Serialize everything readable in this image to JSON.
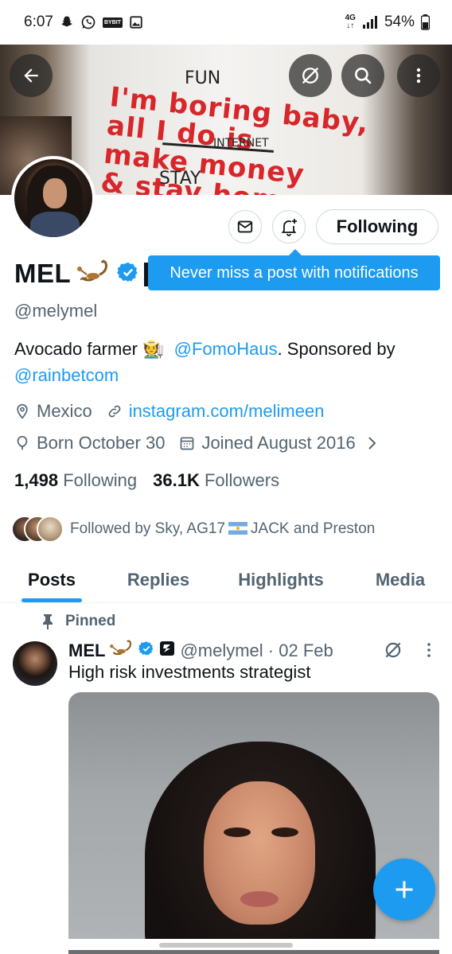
{
  "status_bar": {
    "time": "6:07",
    "bybit_label": "BYBIT",
    "network": "4G",
    "battery": "54%"
  },
  "banner": {
    "shirt_text": "I'm boring baby,\nall I do is\nmake money\n& stay home.",
    "scribble_fun": "FUN",
    "scribble_internet": "INTERNET",
    "scribble_stay": "STAY"
  },
  "actions": {
    "following_label": "Following"
  },
  "tooltip": {
    "text": "Never miss a post with notifications"
  },
  "profile": {
    "name": "MEL",
    "handle": "@melymel",
    "bio_prefix": "Avocado farmer 🧑‍🌾",
    "bio_mention1": "@FomoHaus",
    "bio_middle": ". Sponsored by",
    "bio_mention2": "@rainbetcom",
    "location": "Mexico",
    "website": "instagram.com/melimeen",
    "birthday": "Born October 30",
    "joined": "Joined August 2016",
    "following_count": "1,498",
    "following_label": "Following",
    "followers_count": "36.1K",
    "followers_label": "Followers",
    "followed_by_prefix": "Followed by Sky, AG17",
    "followed_by_suffix": "JACK and Preston"
  },
  "tabs": [
    {
      "label": "Posts"
    },
    {
      "label": "Replies"
    },
    {
      "label": "Highlights"
    },
    {
      "label": "Media"
    }
  ],
  "pinned_post": {
    "pinned_label": "Pinned",
    "author": "MEL",
    "handle_date": "@melymel · 02 Feb",
    "text": "High risk investments strategist"
  },
  "colors": {
    "accent": "#1d9bf0",
    "text_primary": "#0f1419",
    "text_secondary": "#536471"
  }
}
